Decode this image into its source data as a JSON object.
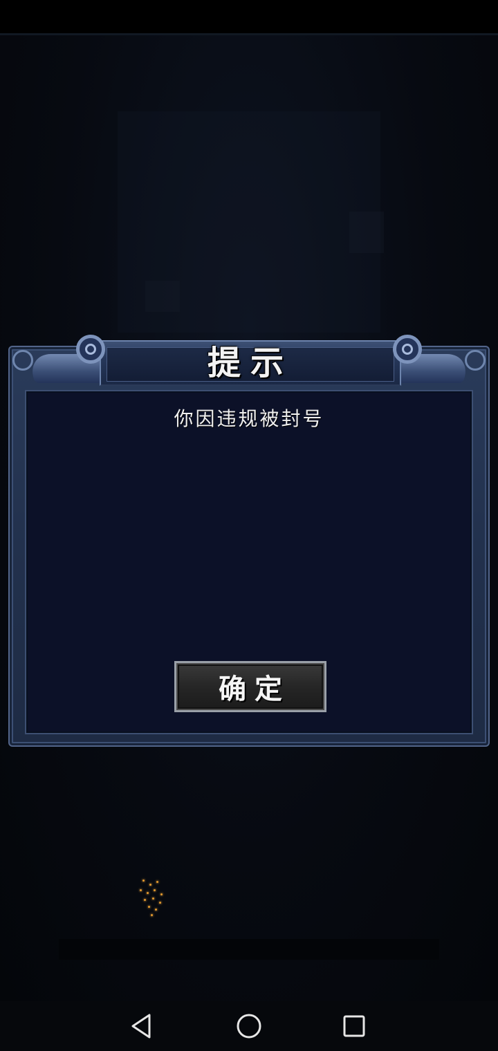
{
  "dialog": {
    "title": "提示",
    "message": "你因违规被封号",
    "confirm_label": "确定"
  },
  "nav": {
    "back": "back-triangle-icon",
    "home": "home-circle-icon",
    "recent": "recent-apps-square-icon"
  },
  "colors": {
    "dialog_frame": "#22314d",
    "dialog_inner": "#0c1128",
    "button_bg": "#262626",
    "text": "#f0f0f0"
  }
}
